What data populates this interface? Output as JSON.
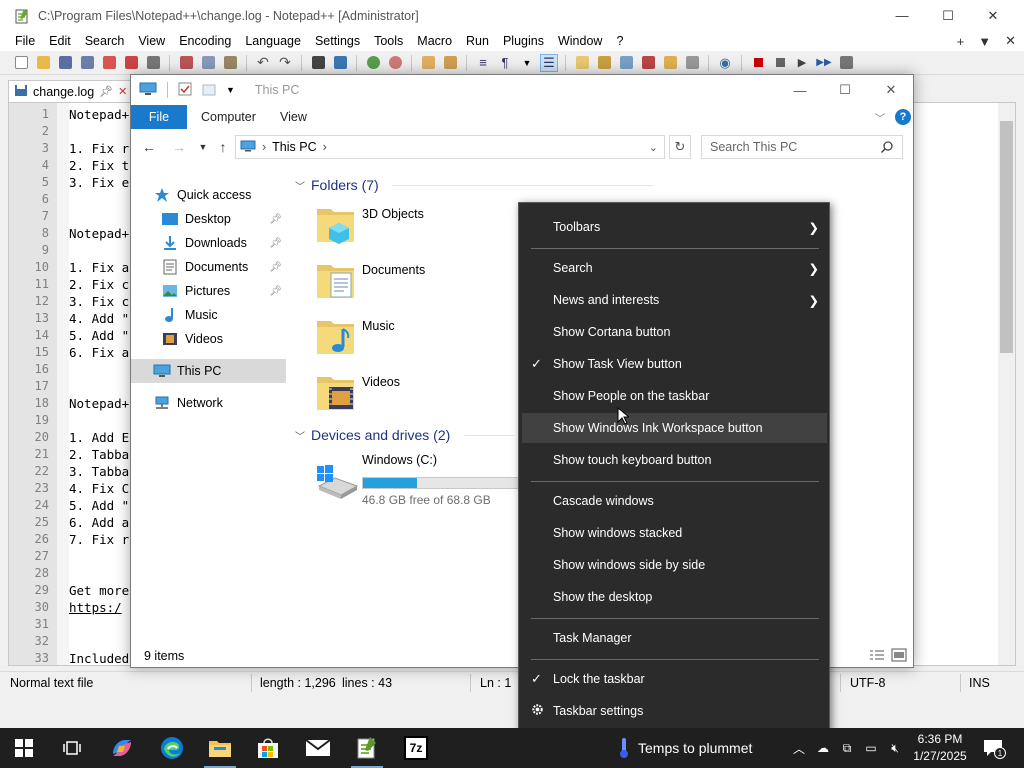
{
  "npp": {
    "title": "C:\\Program Files\\Notepad++\\change.log - Notepad++ [Administrator]",
    "menu": [
      "File",
      "Edit",
      "Search",
      "View",
      "Encoding",
      "Language",
      "Settings",
      "Tools",
      "Macro",
      "Run",
      "Plugins",
      "Window",
      "?"
    ],
    "menu_right": {
      "plus": "+",
      "down": "▼",
      "close": "✕"
    },
    "tab_label": "change.log",
    "lines": [
      {
        "n": "1",
        "t": "Notepad+"
      },
      {
        "n": "2",
        "t": ""
      },
      {
        "n": "3",
        "t": "1. Fix r"
      },
      {
        "n": "4",
        "t": "2. Fix t"
      },
      {
        "n": "5",
        "t": "3. Fix e"
      },
      {
        "n": "6",
        "t": ""
      },
      {
        "n": "7",
        "t": ""
      },
      {
        "n": "8",
        "t": "Notepad+"
      },
      {
        "n": "9",
        "t": ""
      },
      {
        "n": "10",
        "t": "1. Fix a"
      },
      {
        "n": "11",
        "t": "2. Fix c"
      },
      {
        "n": "12",
        "t": "3. Fix c"
      },
      {
        "n": "13",
        "t": "4. Add \""
      },
      {
        "n": "14",
        "t": "5. Add \""
      },
      {
        "n": "15",
        "t": "6. Fix a"
      },
      {
        "n": "16",
        "t": ""
      },
      {
        "n": "17",
        "t": ""
      },
      {
        "n": "18",
        "t": "Notepad+"
      },
      {
        "n": "19",
        "t": ""
      },
      {
        "n": "20",
        "t": "1. Add E"
      },
      {
        "n": "21",
        "t": "2. Tabba"
      },
      {
        "n": "22",
        "t": "3. Tabba"
      },
      {
        "n": "23",
        "t": "4. Fix C"
      },
      {
        "n": "24",
        "t": "5. Add \""
      },
      {
        "n": "25",
        "t": "6. Add a"
      },
      {
        "n": "26",
        "t": "7. Fix r"
      },
      {
        "n": "27",
        "t": ""
      },
      {
        "n": "28",
        "t": ""
      },
      {
        "n": "29",
        "t": "Get more"
      },
      {
        "n": "30",
        "t": "https:/"
      },
      {
        "n": "31",
        "t": ""
      },
      {
        "n": "32",
        "t": ""
      },
      {
        "n": "33",
        "t": "Included"
      }
    ],
    "status": {
      "type": "Normal text file",
      "length": "length : 1,296",
      "lines": "lines : 43",
      "ln": "Ln : 1",
      "encoding": "UTF-8",
      "mode": "INS"
    }
  },
  "explorer": {
    "title": "This PC",
    "ribbon_tabs": [
      "File",
      "Computer",
      "View"
    ],
    "breadcrumb": "This PC",
    "search_placeholder": "Search This PC",
    "nav": [
      {
        "label": "Quick access",
        "icon": "star-icon",
        "pin": false
      },
      {
        "label": "Desktop",
        "icon": "desktop-folder-icon",
        "pin": true
      },
      {
        "label": "Downloads",
        "icon": "downloads-folder-icon",
        "pin": true
      },
      {
        "label": "Documents",
        "icon": "documents-folder-icon",
        "pin": true
      },
      {
        "label": "Pictures",
        "icon": "pictures-folder-icon",
        "pin": true
      },
      {
        "label": "Music",
        "icon": "music-icon",
        "pin": false
      },
      {
        "label": "Videos",
        "icon": "videos-icon",
        "pin": false
      },
      {
        "label": "This PC",
        "icon": "computer-icon",
        "pin": false
      },
      {
        "label": "Network",
        "icon": "network-icon",
        "pin": false
      }
    ],
    "folders_header": "Folders (7)",
    "folders": [
      "3D Objects",
      "Documents",
      "Music",
      "Videos"
    ],
    "drives_header": "Devices and drives (2)",
    "drive": {
      "name": "Windows (C:)",
      "free": "46.8 GB free of 68.8 GB",
      "used_fraction": 0.32
    },
    "item_count": "9 items",
    "colors": {
      "file_tab": "#1979ca",
      "drive_fill": "#26a0da",
      "group_header": "#1e3287"
    }
  },
  "context_menu": {
    "items": [
      {
        "label": "Toolbars",
        "submenu": true,
        "checked": false
      },
      {
        "sep": true
      },
      {
        "label": "Search",
        "submenu": true,
        "checked": false
      },
      {
        "label": "News and interests",
        "submenu": true,
        "checked": false
      },
      {
        "label": "Show Cortana button",
        "submenu": false,
        "checked": false
      },
      {
        "label": "Show Task View button",
        "submenu": false,
        "checked": true
      },
      {
        "label": "Show People on the taskbar",
        "submenu": false,
        "checked": false
      },
      {
        "label": "Show Windows Ink Workspace button",
        "submenu": false,
        "checked": false,
        "hover": true
      },
      {
        "label": "Show touch keyboard button",
        "submenu": false,
        "checked": false
      },
      {
        "sep": true
      },
      {
        "label": "Cascade windows",
        "submenu": false,
        "checked": false
      },
      {
        "label": "Show windows stacked",
        "submenu": false,
        "checked": false
      },
      {
        "label": "Show windows side by side",
        "submenu": false,
        "checked": false
      },
      {
        "label": "Show the desktop",
        "submenu": false,
        "checked": false
      },
      {
        "sep": true
      },
      {
        "label": "Task Manager",
        "submenu": false,
        "checked": false
      },
      {
        "sep": true
      },
      {
        "label": "Lock the taskbar",
        "submenu": false,
        "checked": true
      },
      {
        "label": "Taskbar settings",
        "submenu": false,
        "checked": false,
        "gear": true
      }
    ],
    "check_glyph": "✓",
    "arrow_glyph": "❯"
  },
  "taskbar": {
    "weather": "Temps to plummet",
    "time": "6:36 PM",
    "date": "1/27/2025",
    "notif_count": "1",
    "apps": [
      "start-icon",
      "task-view-icon",
      "copilot-icon",
      "edge-icon",
      "file-explorer-icon",
      "store-icon",
      "mail-icon",
      "notepadpp-icon",
      "7zip-icon"
    ],
    "sevenzip_label": "7z"
  }
}
